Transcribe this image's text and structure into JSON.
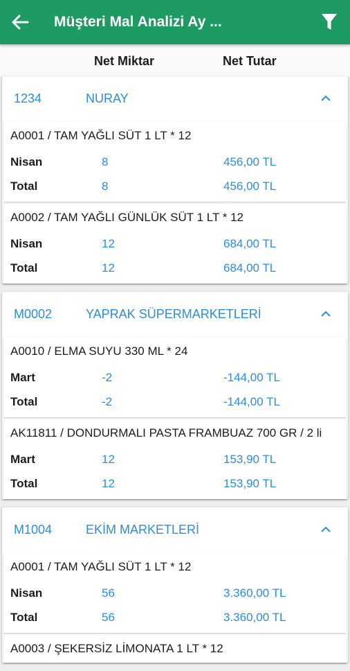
{
  "appbar": {
    "title": "Müşteri Mal Analizi Ay ..."
  },
  "columns": {
    "qty": "Net Miktar",
    "amount": "Net Tutar"
  },
  "customers": [
    {
      "code": "1234",
      "name": "NURAY",
      "items": [
        {
          "product": "A0001 / TAM YAĞLI SÜT 1 LT * 12",
          "rows": [
            {
              "label": "Nisan",
              "qty": "8",
              "amount": "456,00 TL"
            },
            {
              "label": "Total",
              "qty": "8",
              "amount": "456,00 TL"
            }
          ]
        },
        {
          "product": "A0002 / TAM YAĞLI GÜNLÜK SÜT 1 LT * 12",
          "rows": [
            {
              "label": "Nisan",
              "qty": "12",
              "amount": "684,00 TL"
            },
            {
              "label": "Total",
              "qty": "12",
              "amount": "684,00 TL"
            }
          ]
        }
      ]
    },
    {
      "code": "M0002",
      "name": "YAPRAK SÜPERMARKETLERİ",
      "items": [
        {
          "product": "A0010 / ELMA SUYU 330 ML * 24",
          "rows": [
            {
              "label": "Mart",
              "qty": "-2",
              "amount": "-144,00 TL"
            },
            {
              "label": "Total",
              "qty": "-2",
              "amount": "-144,00 TL"
            }
          ]
        },
        {
          "product": "AK11811 / DONDURMALI PASTA FRAMBUAZ 700 GR / 2 li",
          "rows": [
            {
              "label": "Mart",
              "qty": "12",
              "amount": "153,90 TL"
            },
            {
              "label": "Total",
              "qty": "12",
              "amount": "153,90 TL"
            }
          ]
        }
      ]
    },
    {
      "code": "M1004",
      "name": "EKİM MARKETLERİ",
      "items": [
        {
          "product": "A0001 / TAM YAĞLI SÜT 1 LT * 12",
          "rows": [
            {
              "label": "Nisan",
              "qty": "56",
              "amount": "3.360,00 TL"
            },
            {
              "label": "Total",
              "qty": "56",
              "amount": "3.360,00 TL"
            }
          ]
        },
        {
          "product": "A0003 / ŞEKERSİZ LİMONATA 1 LT * 12",
          "rows": []
        }
      ]
    }
  ],
  "colors": {
    "appbar": "#1e9a63",
    "link": "#2c8ed6"
  },
  "icons": {
    "back": "arrow-left-icon",
    "filter": "filter-icon",
    "collapse": "chevron-up-icon"
  }
}
